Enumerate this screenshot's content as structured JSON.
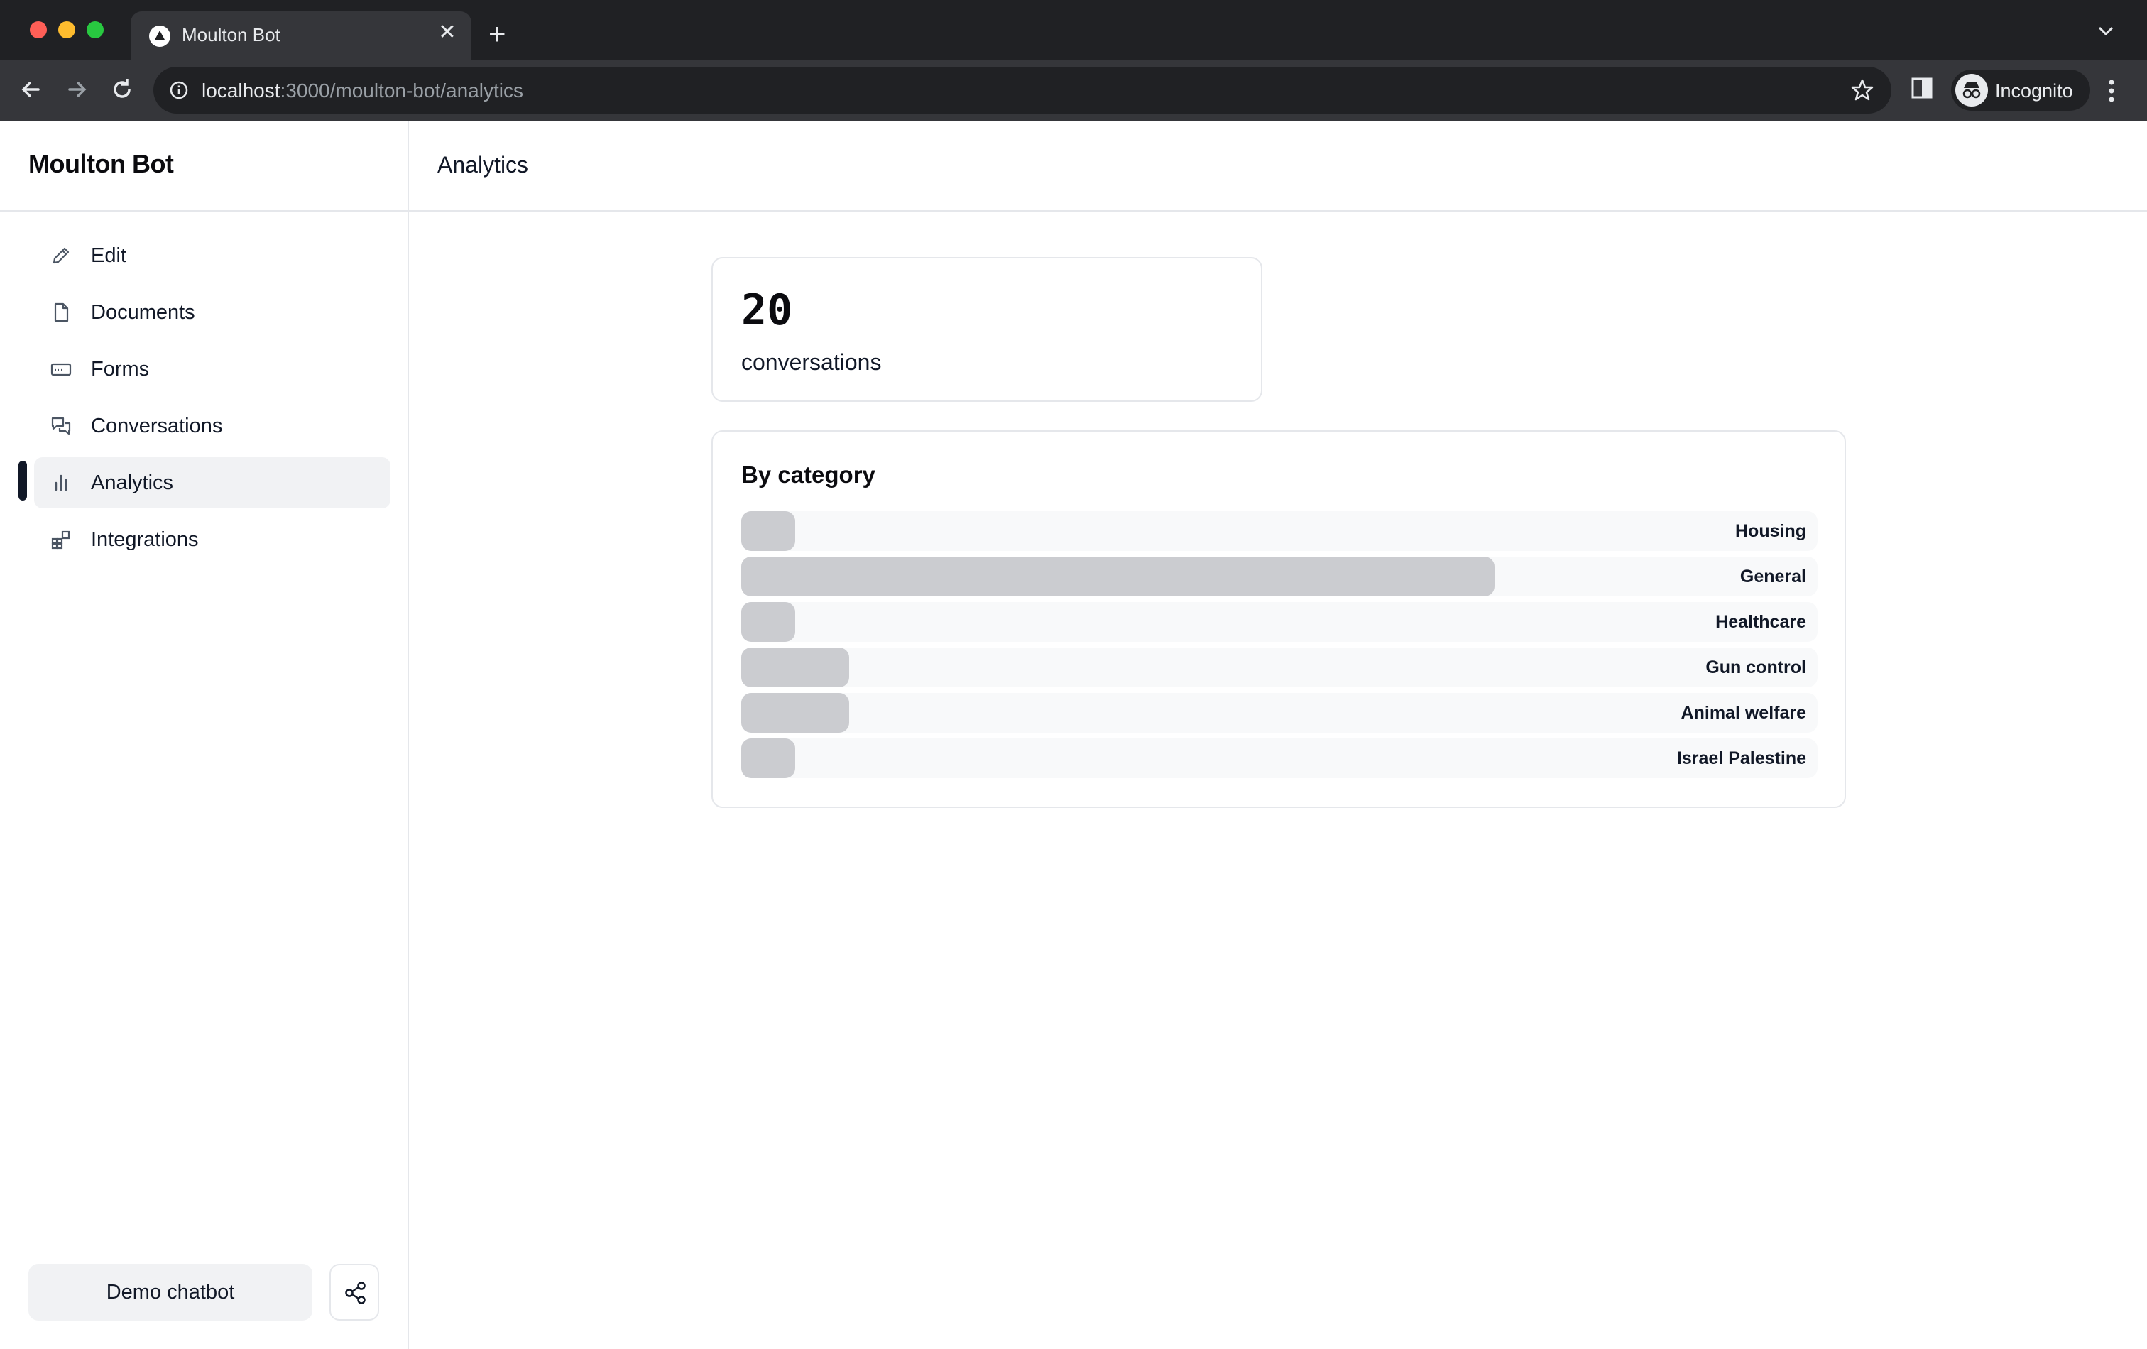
{
  "browser": {
    "tab_title": "Moulton Bot",
    "url_host": "localhost",
    "url_path": ":3000/moulton-bot/analytics",
    "profile_label": "Incognito"
  },
  "sidebar": {
    "brand": "Moulton Bot",
    "items": [
      {
        "label": "Edit",
        "icon": "pencil-icon"
      },
      {
        "label": "Documents",
        "icon": "document-icon"
      },
      {
        "label": "Forms",
        "icon": "form-icon"
      },
      {
        "label": "Conversations",
        "icon": "chat-icon"
      },
      {
        "label": "Analytics",
        "icon": "bar-chart-icon",
        "active": true
      },
      {
        "label": "Integrations",
        "icon": "grid-plus-icon"
      }
    ],
    "demo_button": "Demo chatbot",
    "share_icon": "share-icon"
  },
  "main": {
    "title": "Analytics",
    "stat": {
      "value": "20",
      "label": "conversations"
    },
    "category_card": {
      "title": "By category"
    }
  },
  "colors": {
    "bar_fill": "#cbccd0",
    "bar_track": "#f8f9fa",
    "active_indicator": "#111827"
  },
  "chart_data": {
    "type": "bar",
    "orientation": "horizontal",
    "title": "By category",
    "categories": [
      "Housing",
      "General",
      "Healthcare",
      "Gun control",
      "Animal welfare",
      "Israel Palestine"
    ],
    "values": [
      1,
      14,
      1,
      2,
      2,
      1
    ],
    "xlim": [
      0,
      20
    ]
  }
}
